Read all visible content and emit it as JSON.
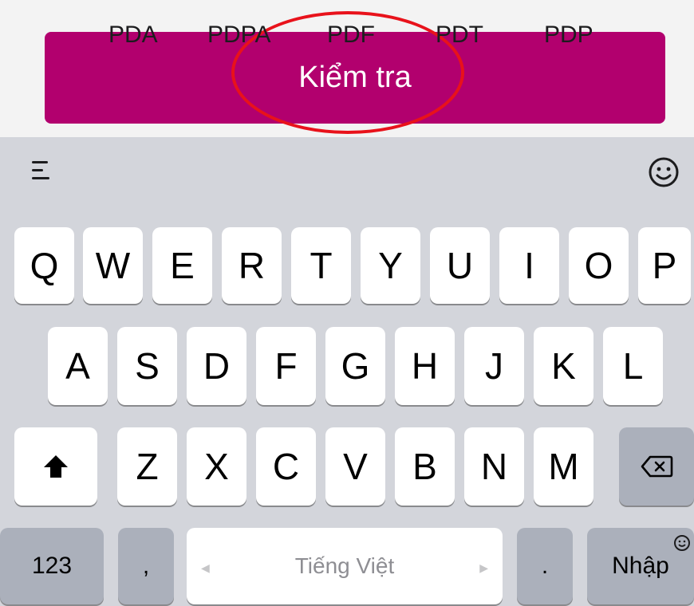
{
  "action_button": {
    "label": "Kiểm tra",
    "color": "#b2006e"
  },
  "highlight_color": "#e8121b",
  "suggestions": [
    "PDA",
    "PDPA",
    "PDF",
    "PDT",
    "PDP"
  ],
  "icons": {
    "menu": "menu-lines-icon",
    "emoji": "emoji-icon",
    "shift": "shift-arrow-icon",
    "backspace": "backspace-icon",
    "globe": "emoji-small-icon"
  },
  "keyboard": {
    "row1": [
      "Q",
      "W",
      "E",
      "R",
      "T",
      "Y",
      "U",
      "I",
      "O",
      "P"
    ],
    "row2": [
      "A",
      "S",
      "D",
      "F",
      "G",
      "H",
      "J",
      "K",
      "L"
    ],
    "row3": [
      "Z",
      "X",
      "C",
      "V",
      "B",
      "N",
      "M"
    ],
    "numbers_label": "123",
    "comma_label": ",",
    "space_label": "Tiếng Việt",
    "period_label": ".",
    "return_label": "Nhập"
  }
}
